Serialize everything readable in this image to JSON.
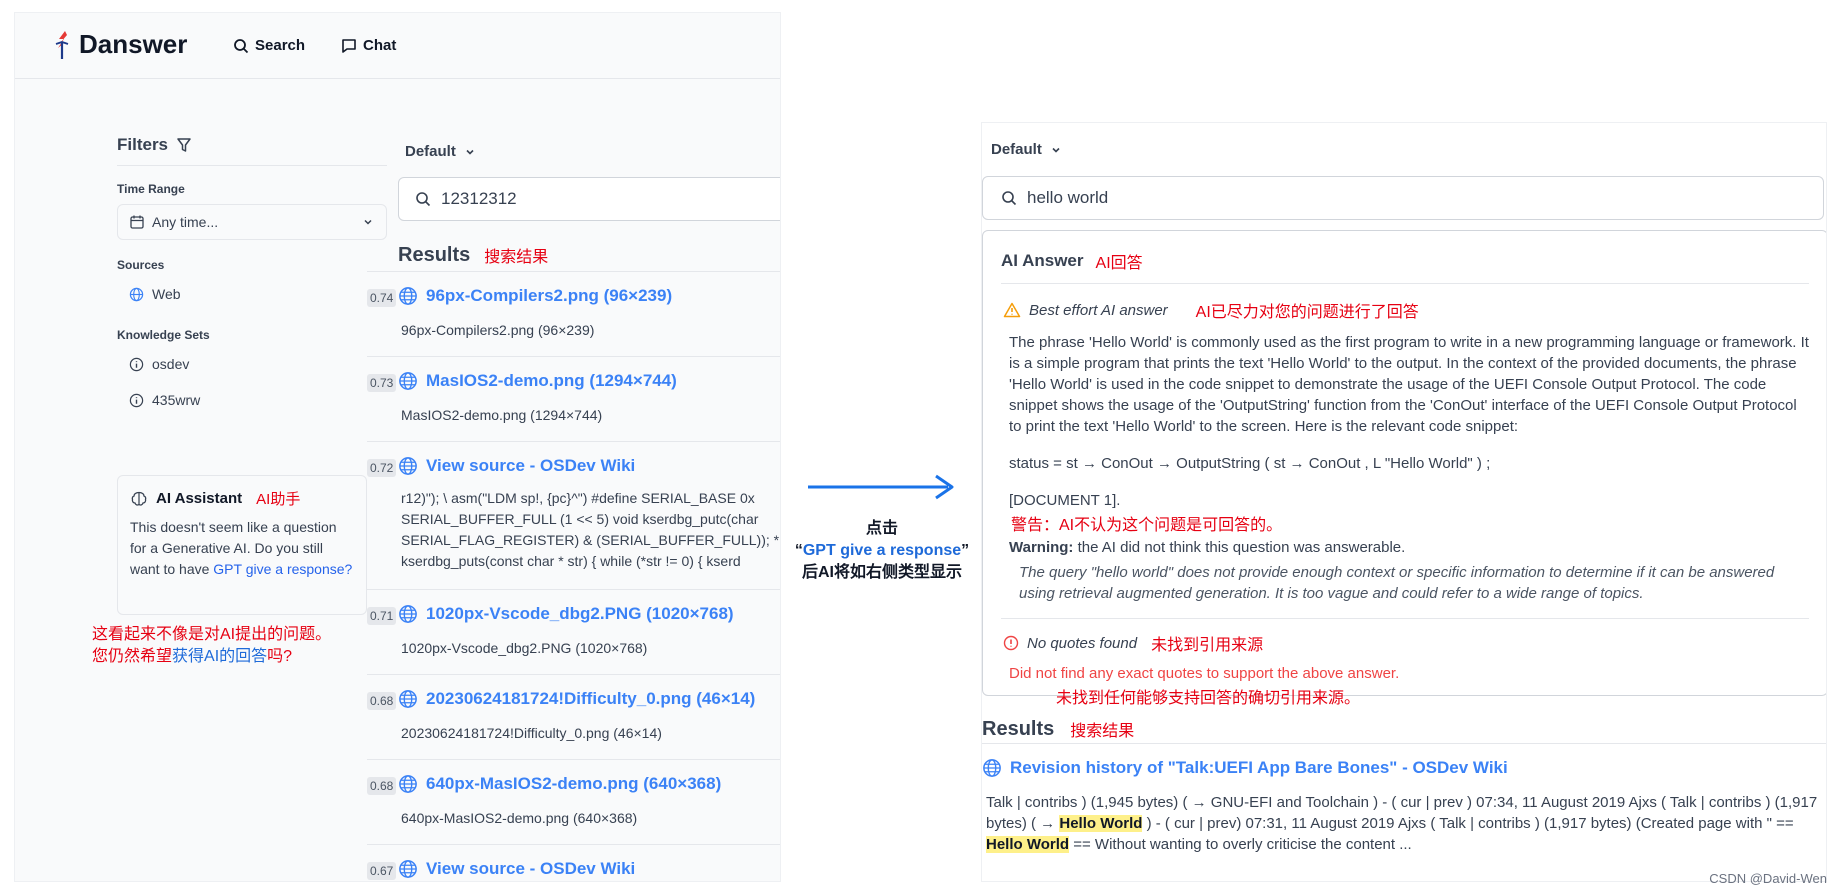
{
  "left": {
    "app_name": "Danswer",
    "nav": {
      "search": "Search",
      "chat": "Chat"
    },
    "filters": {
      "title": "Filters",
      "time_range_label": "Time Range",
      "time_range_value": "Any time...",
      "sources_label": "Sources",
      "sources": [
        "Web"
      ],
      "knowledge_sets_label": "Knowledge Sets",
      "knowledge_sets": [
        "osdev",
        "435wrw"
      ]
    },
    "ai_assistant": {
      "title": "AI Assistant",
      "title_cn": "AI助手",
      "body": "This doesn't seem like a question for a Generative AI. Do you still want to have ",
      "link": "GPT give a response?"
    },
    "note_cn_line1": "这看起来不像是对AI提出的问题。",
    "note_cn_line2a": "您仍然希望",
    "note_cn_line2b": "获得AI的回答",
    "note_cn_line2c": "吗?",
    "default_selector": "Default",
    "search_query": "12312312",
    "results_title": "Results",
    "results_title_cn": "搜索结果",
    "results": [
      {
        "score": "0.74",
        "title": "96px-Compilers2.png (96×239)",
        "sub": "96px-Compilers2.png (96×239)"
      },
      {
        "score": "0.73",
        "title": "MasIOS2-demo.png (1294×744)",
        "sub": "MasIOS2-demo.png (1294×744)"
      },
      {
        "score": "0.72",
        "title": "View source - OSDev Wiki",
        "code": [
          "r12)\"); \\ asm(\"LDM sp!, {pc}^\") #define SERIAL_BASE 0x",
          "SERIAL_BUFFER_FULL (1 << 5) void kserdbg_putc(char",
          "SERIAL_FLAG_REGISTER) & (SERIAL_BUFFER_FULL)); *",
          "kserdbg_puts(const char * str) { while (*str != 0) { kserd"
        ]
      },
      {
        "score": "0.71",
        "title": "1020px-Vscode_dbg2.PNG (1020×768)",
        "sub": "1020px-Vscode_dbg2.PNG (1020×768)"
      },
      {
        "score": "0.68",
        "title": "20230624181724!Difficulty_0.png (46×14)",
        "sub": "20230624181724!Difficulty_0.png (46×14)"
      },
      {
        "score": "0.68",
        "title": "640px-MasIOS2-demo.png (640×368)",
        "sub": "640px-MasIOS2-demo.png (640×368)"
      },
      {
        "score": "0.67",
        "title": "View source - OSDev Wiki"
      }
    ]
  },
  "middle": {
    "line1": "点击",
    "line2_open": "“",
    "line2_link": "GPT give a response",
    "line2_close": "”",
    "line3": "后AI将如右侧类型显示"
  },
  "right": {
    "default_selector": "Default",
    "search_query": "hello world",
    "ai_answer_title": "AI Answer",
    "ai_answer_title_cn": "AI回答",
    "best_effort": "Best effort AI answer",
    "best_effort_cn": "AI已尽力对您的问题进行了回答",
    "answer_text": "The phrase 'Hello World' is commonly used as the first program to write in a new programming language or framework. It is a simple program that prints the text 'Hello World' to the output. In the context of the provided documents, the phrase 'Hello World' is used in the code snippet to demonstrate the usage of the UEFI Console Output Protocol. The code snippet shows the usage of the 'OutputString' function from the 'ConOut' interface of the UEFI Console Output Protocol to print the text 'Hello World' to the screen. Here is the relevant code snippet:",
    "answer_code": "status = st → ConOut → OutputString ( st → ConOut , L \"Hello World\" ) ;",
    "answer_doc": "[DOCUMENT 1].",
    "warning_cn": "警告：AI不认为这个问题是可回答的。",
    "warning_label": "Warning:",
    "warning_text": " the AI did not think this question was answerable.",
    "warning_detail": "The query \"hello world\" does not provide enough context or specific information to determine if it can be answered using retrieval augmented generation. It is too vague and could refer to a wide range of topics.",
    "no_quotes": "No quotes found",
    "no_quotes_cn": "未找到引用来源",
    "no_quotes_msg": "Did not find any exact quotes to support the above answer.",
    "no_quotes_msg_cn": "未找到任何能够支持回答的确切引用来源。",
    "results_title": "Results",
    "results_title_cn": "搜索结果",
    "result": {
      "title": "Revision history of \"Talk:UEFI App Bare Bones\" - OSDev Wiki",
      "body_a": "Talk | contribs )  (1,945 bytes) ( → GNU-EFI and Toolchain ) - ( cur | prev ) 07:34, 11 August 2019  Ajxs ( Talk | contribs ) (1,917 bytes) ( → ",
      "body_hl1": "Hello World",
      "body_b": " ) - ( cur | prev) 07:31, 11 August 2019  Ajxs ( Talk | contribs )  (1,917 bytes) (Created page with \" == ",
      "body_hl2": "Hello World",
      "body_c": " == Without wanting to overly criticise the content ..."
    }
  },
  "watermark": "CSDN @David-Wen",
  "colors": {
    "accent": "#3b82f6",
    "annotation_red": "#e60012",
    "annotation_blue": "#1e6ad9",
    "arrow": "#1a73e8",
    "warning": "#f59e0b",
    "error": "#ef4444"
  }
}
